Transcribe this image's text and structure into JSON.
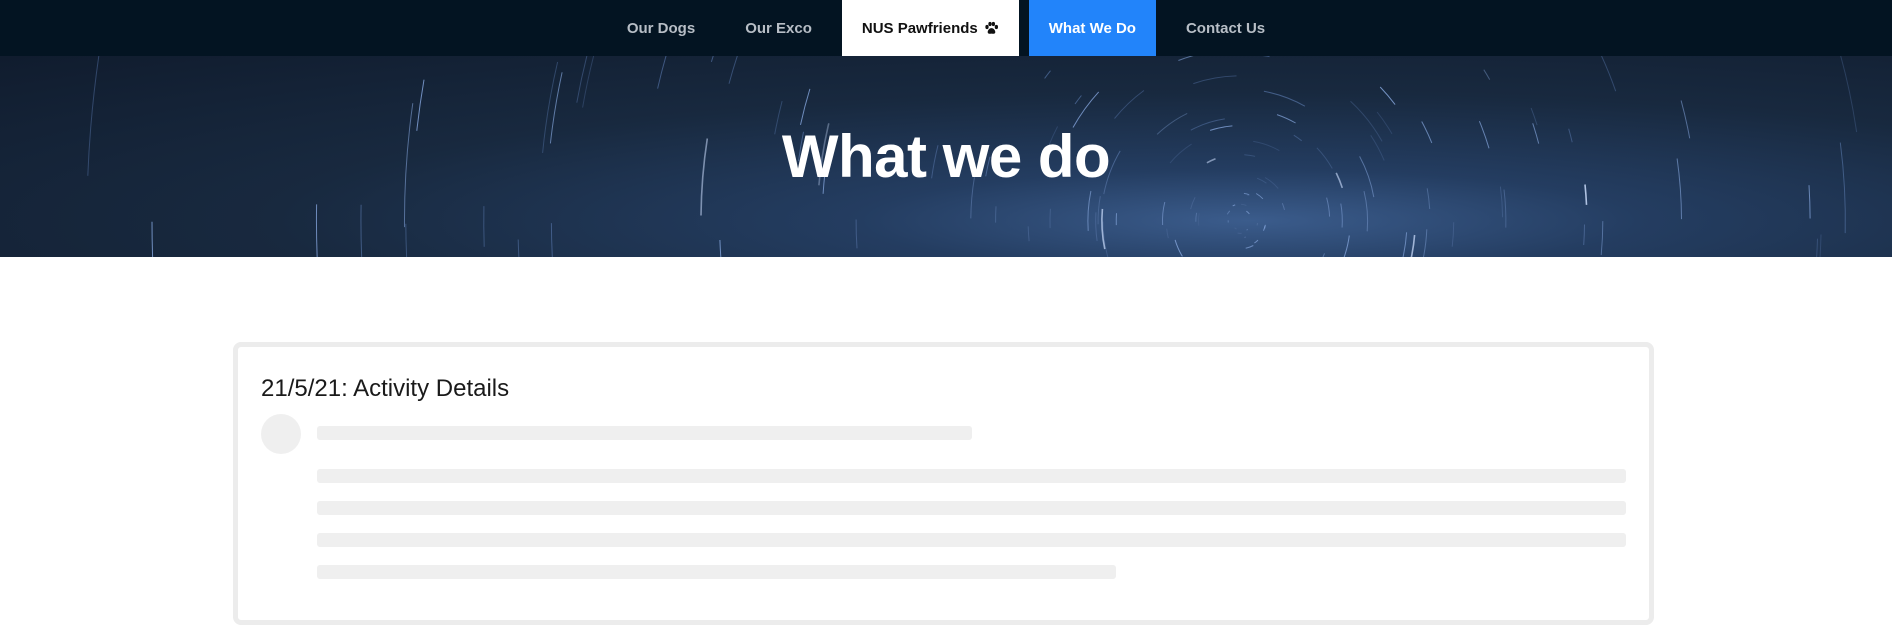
{
  "nav": {
    "items": [
      {
        "label": "Our Dogs"
      },
      {
        "label": "Our Exco"
      },
      {
        "label": "NUS Pawfriends"
      },
      {
        "label": "What We Do"
      },
      {
        "label": "Contact Us"
      }
    ],
    "active": "What We Do",
    "brand_icon": "paw-icon"
  },
  "hero": {
    "title": "What we do"
  },
  "card": {
    "title": "21/5/21: Activity Details"
  },
  "colors": {
    "navbar": "#031422",
    "active_tab": "#2284fa",
    "placeholder": "#efefef"
  }
}
